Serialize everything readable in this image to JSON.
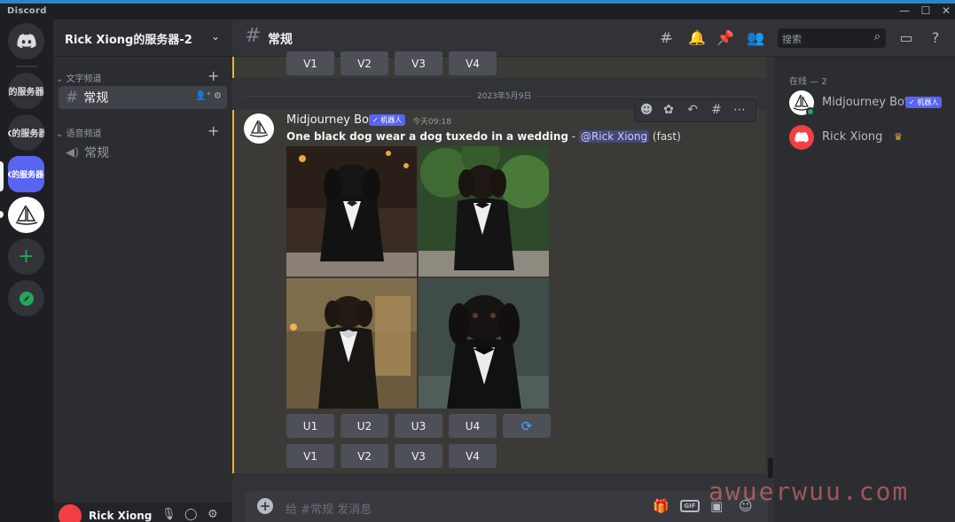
{
  "window": {
    "brand": "Discord",
    "minimize": "—",
    "maximize": "☐",
    "close": "✕"
  },
  "servers": [
    {
      "label": "",
      "icon": "discord-home-icon"
    },
    {
      "label": "的服务器"
    },
    {
      "label": "X的服务器"
    },
    {
      "label": "X的服务器-"
    },
    {
      "label": "",
      "icon": "midjourney-sailboat-icon"
    },
    {
      "label": "+",
      "icon": "add-server-icon"
    },
    {
      "label": "",
      "icon": "compass-explore-icon"
    }
  ],
  "sidebar": {
    "guild_name": "Rick Xiong的服务器-2",
    "text_category": "文字频道",
    "voice_category": "语音频道",
    "text_channel": "常规",
    "voice_channel": "常规"
  },
  "user": {
    "name": "Rick Xiong"
  },
  "header": {
    "channel": "常规",
    "search_placeholder": "搜索"
  },
  "message": {
    "date": "2023年5月9日",
    "author": "Midjourney Bot",
    "bot_tag": "✓ 机器人",
    "time": "今天09:18",
    "prompt": "One black dog wear a dog tuxedo in a wedding",
    "sep": " - ",
    "mention": "@Rick Xiong",
    "mode": " (fast)"
  },
  "prev_buttons": [
    "V1",
    "V2",
    "V3",
    "V4"
  ],
  "upscale_buttons": [
    "U1",
    "U2",
    "U3",
    "U4"
  ],
  "variation_buttons": [
    "V1",
    "V2",
    "V3",
    "V4"
  ],
  "composer": {
    "placeholder": "给 #常规 发消息"
  },
  "members": {
    "heading": "在线 — 2",
    "list": [
      {
        "name": "Midjourney Bot",
        "tag": "✓ 机器人"
      },
      {
        "name": "Rick Xiong",
        "badge": "♛"
      }
    ]
  },
  "watermark": "awuerwuu.com",
  "colors": {
    "accent": "#5865f2",
    "online": "#23a55a",
    "highlight_bar": "#f0b232",
    "danger": "#f23f43"
  }
}
